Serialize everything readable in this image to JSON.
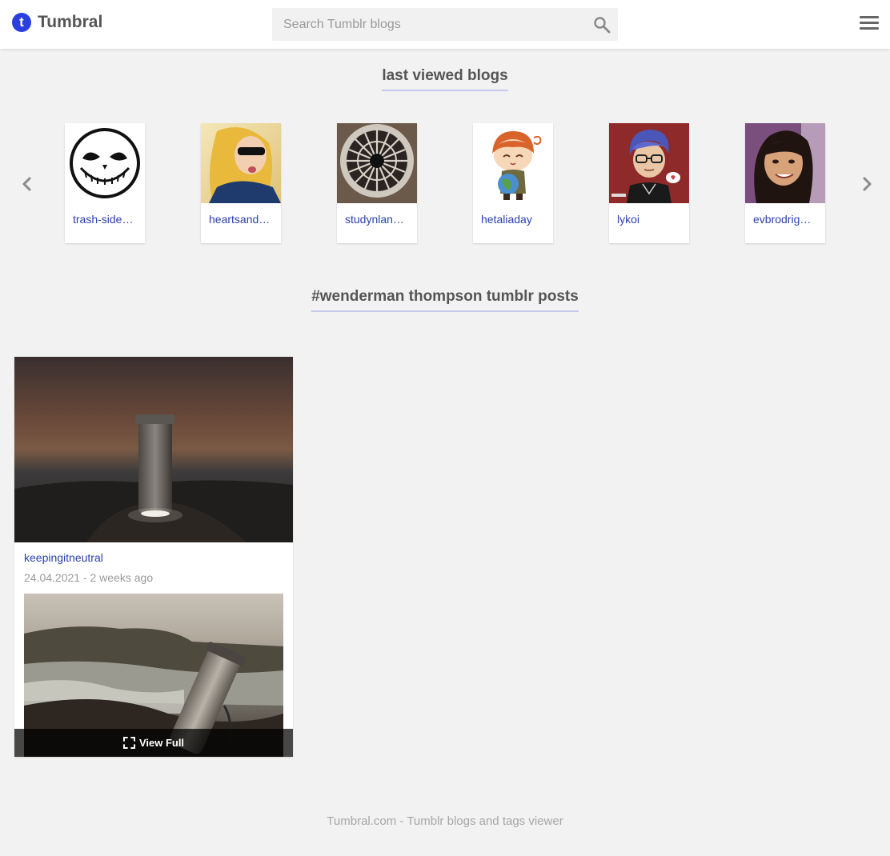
{
  "header": {
    "logo_letter": "t",
    "logo_text": "Tumbral",
    "search_placeholder": "Search Tumblr blogs",
    "search_icon": "search-icon",
    "menu_icon": "hamburger-menu-icon"
  },
  "last_viewed": {
    "title": "last viewed blogs",
    "prev_icon": "chevron-left-icon",
    "next_icon": "chevron-right-icon",
    "blogs": [
      {
        "name": "trash-side-…"
      },
      {
        "name": "heartsand…"
      },
      {
        "name": "studynlan…"
      },
      {
        "name": "hetaliaday"
      },
      {
        "name": "lykoi"
      },
      {
        "name": "evbrodrig…"
      }
    ]
  },
  "tag_section": {
    "title": "#wenderman thompson tumblr posts"
  },
  "post": {
    "author": "keepingitneutral",
    "date": "24.04.2021 - 2 weeks ago",
    "view_full_label": "View Full",
    "view_full_icon": "fullscreen-icon"
  },
  "footer": {
    "text": "Tumbral.com - Tumblr blogs and tags viewer"
  },
  "colors": {
    "accent": "#2a3fe0",
    "link": "#2a3fae",
    "background": "#f2f2f2",
    "title_underline": "#c5c8ea"
  }
}
